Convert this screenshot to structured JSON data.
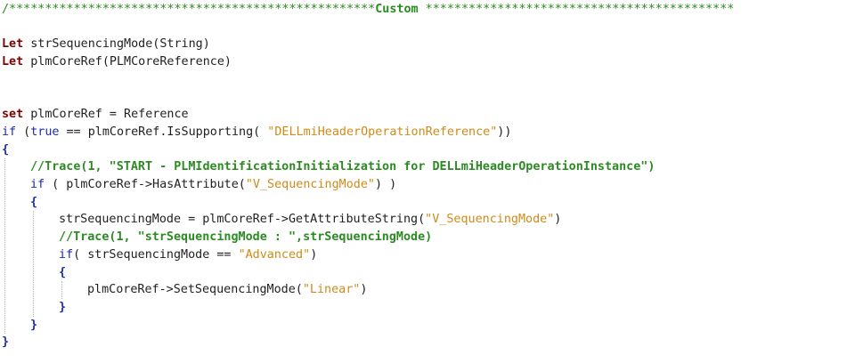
{
  "editor": {
    "lines": [
      {
        "indent": 0,
        "tokens": [
          {
            "t": "/***************************************************",
            "c": "cm"
          },
          {
            "t": "Custom",
            "c": "cmb"
          },
          {
            "t": " *******************************************",
            "c": "cm"
          }
        ]
      },
      {
        "indent": 0,
        "tokens": []
      },
      {
        "indent": 0,
        "tokens": [
          {
            "t": "Let",
            "c": "kw"
          },
          {
            "t": " strSequencingMode(String)",
            "c": "plain"
          }
        ]
      },
      {
        "indent": 0,
        "tokens": [
          {
            "t": "Let",
            "c": "kw"
          },
          {
            "t": " plmCoreRef(PLMCoreReference)",
            "c": "plain"
          }
        ]
      },
      {
        "indent": 0,
        "tokens": []
      },
      {
        "indent": 0,
        "tokens": []
      },
      {
        "indent": 0,
        "tokens": [
          {
            "t": "set",
            "c": "kw"
          },
          {
            "t": " plmCoreRef = Reference",
            "c": "plain"
          }
        ]
      },
      {
        "indent": 0,
        "tokens": [
          {
            "t": "if",
            "c": "kw2"
          },
          {
            "t": " (",
            "c": "plain"
          },
          {
            "t": "true",
            "c": "kw2"
          },
          {
            "t": " == plmCoreRef.IsSupporting( ",
            "c": "plain"
          },
          {
            "t": "\"DELLmiHeaderOperationReference\"",
            "c": "str"
          },
          {
            "t": "))",
            "c": "plain"
          }
        ]
      },
      {
        "indent": 0,
        "tokens": [
          {
            "t": "{",
            "c": "br"
          }
        ]
      },
      {
        "indent": 4,
        "tokens": [
          {
            "t": "//Trace(1, \"START - PLMIdentificationInitialization for DELLmiHeaderOperationInstance\")",
            "c": "cmb"
          }
        ]
      },
      {
        "indent": 4,
        "tokens": [
          {
            "t": "if",
            "c": "kw2"
          },
          {
            "t": " ( plmCoreRef->HasAttribute(",
            "c": "plain"
          },
          {
            "t": "\"V_SequencingMode\"",
            "c": "str"
          },
          {
            "t": ") )",
            "c": "plain"
          }
        ]
      },
      {
        "indent": 4,
        "tokens": [
          {
            "t": "{",
            "c": "br"
          }
        ]
      },
      {
        "indent": 8,
        "tokens": [
          {
            "t": "strSequencingMode = plmCoreRef->GetAttributeString(",
            "c": "plain"
          },
          {
            "t": "\"V_SequencingMode\"",
            "c": "str"
          },
          {
            "t": ")",
            "c": "plain"
          }
        ]
      },
      {
        "indent": 8,
        "tokens": [
          {
            "t": "//Trace(1, \"strSequencingMode : \",strSequencingMode)",
            "c": "cmb"
          }
        ]
      },
      {
        "indent": 8,
        "tokens": [
          {
            "t": "if",
            "c": "kw2"
          },
          {
            "t": "( strSequencingMode == ",
            "c": "plain"
          },
          {
            "t": "\"Advanced\"",
            "c": "str"
          },
          {
            "t": ")",
            "c": "plain"
          }
        ]
      },
      {
        "indent": 8,
        "tokens": [
          {
            "t": "{",
            "c": "br"
          }
        ]
      },
      {
        "indent": 12,
        "tokens": [
          {
            "t": "plmCoreRef->SetSequencingMode(",
            "c": "plain"
          },
          {
            "t": "\"Linear\"",
            "c": "str"
          },
          {
            "t": ")",
            "c": "plain"
          }
        ]
      },
      {
        "indent": 8,
        "tokens": [
          {
            "t": "}",
            "c": "br"
          }
        ]
      },
      {
        "indent": 4,
        "tokens": [
          {
            "t": "}",
            "c": "br"
          }
        ]
      },
      {
        "indent": 0,
        "tokens": [
          {
            "t": "}",
            "c": "br"
          }
        ]
      }
    ]
  }
}
